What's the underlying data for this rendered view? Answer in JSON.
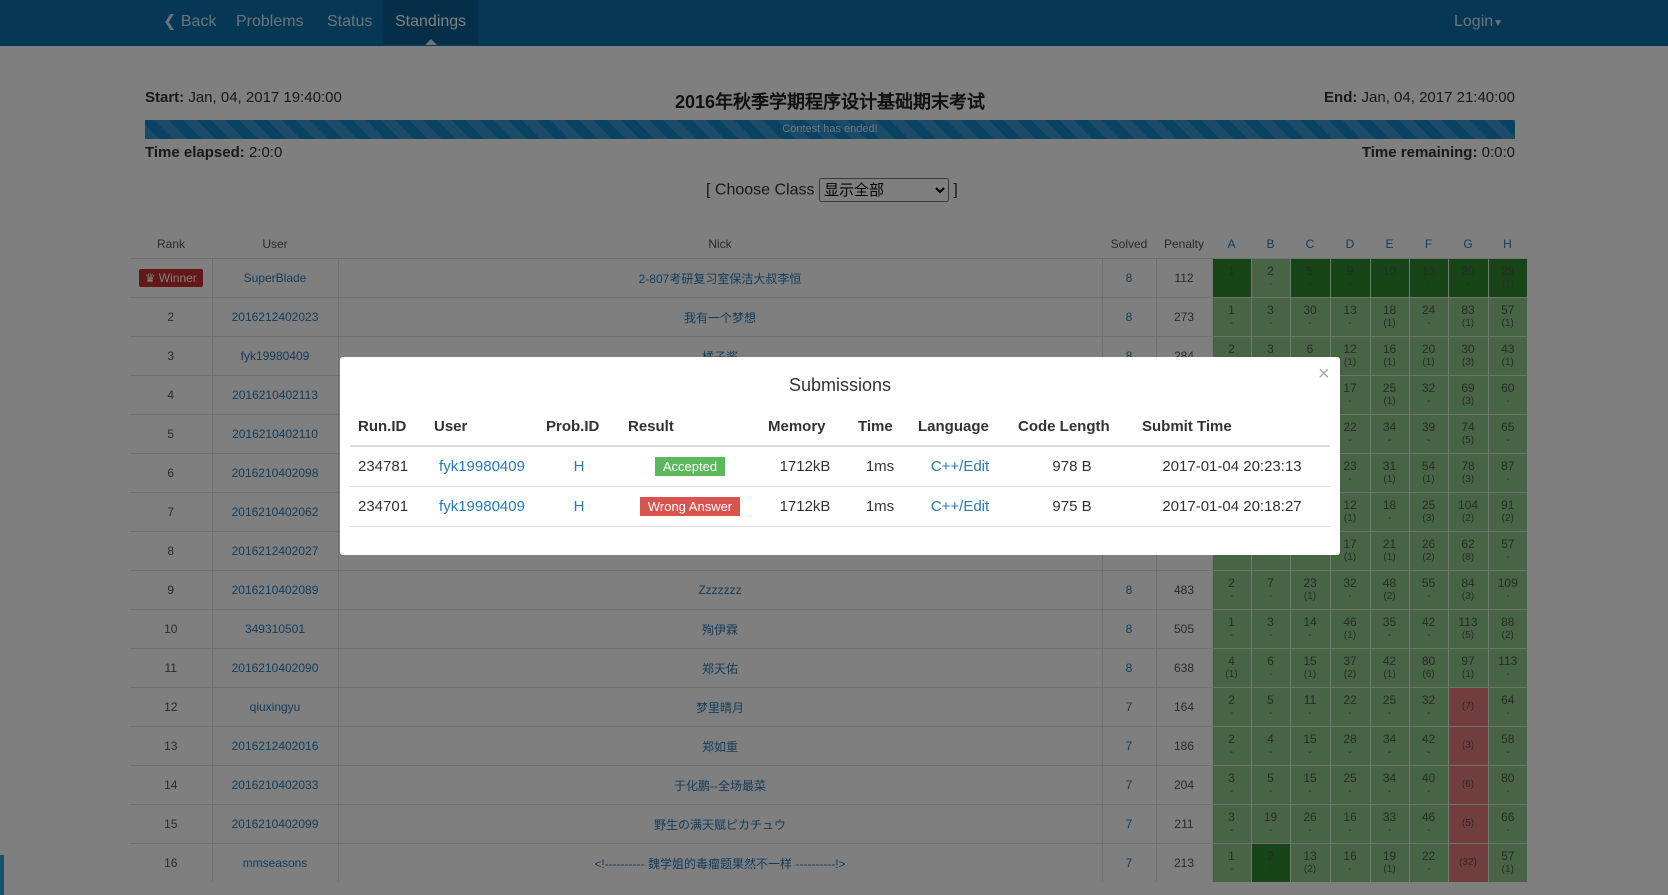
{
  "nav": {
    "back": "Back",
    "problems": "Problems",
    "status": "Status",
    "standings": "Standings",
    "login": "Login"
  },
  "contest": {
    "start_label": "Start:",
    "start": "Jan, 04, 2017 19:40:00",
    "title": "2016年秋季学期程序设计基础期末考试",
    "end_label": "End:",
    "end": "Jan, 04, 2017 21:40:00",
    "progress_text": "Contest has ended!",
    "progress": 1.0,
    "elapsed_label": "Time elapsed:",
    "elapsed": "2:0:0",
    "remaining_label": "Time remaining:",
    "remaining": "0:0:0",
    "choose_class_open": "[ Choose Class",
    "choose_class_close": "]",
    "class_selected": "显示全部"
  },
  "standings": {
    "headers": {
      "rank": "Rank",
      "user": "User",
      "nick": "Nick",
      "solved": "Solved",
      "penalty": "Penalty"
    },
    "problems": [
      "A",
      "B",
      "C",
      "D",
      "E",
      "F",
      "G",
      "H"
    ],
    "winner_label": "Winner",
    "rows": [
      {
        "rank": "Winner",
        "user": "SuperBlade",
        "nick": "2-807考研复习室保洁大叔李恒",
        "solved": "8",
        "penalty": "112",
        "cells": [
          [
            "1",
            "-",
            "first"
          ],
          [
            "2",
            "-",
            "g"
          ],
          [
            "5",
            "-",
            "first"
          ],
          [
            "9",
            "-",
            "first"
          ],
          [
            "10",
            "-",
            "first"
          ],
          [
            "13",
            "-",
            "first"
          ],
          [
            "20",
            "-",
            "first"
          ],
          [
            "28",
            "(1)",
            "first"
          ]
        ]
      },
      {
        "rank": "2",
        "user": "2016212402023",
        "nick": "我有一个梦想",
        "solved": "8",
        "penalty": "273",
        "cells": [
          [
            "1",
            "-",
            "g"
          ],
          [
            "3",
            "-",
            "g"
          ],
          [
            "30",
            "-",
            "g"
          ],
          [
            "13",
            "-",
            "g"
          ],
          [
            "18",
            "(1)",
            "g"
          ],
          [
            "24",
            "-",
            "g"
          ],
          [
            "83",
            "(1)",
            "g"
          ],
          [
            "57",
            "(1)",
            "g"
          ]
        ]
      },
      {
        "rank": "3",
        "user": "fyk19980409",
        "nick": "橘子酱",
        "solved": "8",
        "penalty": "284",
        "cells": [
          [
            "2",
            "-",
            "g"
          ],
          [
            "3",
            "-",
            "g"
          ],
          [
            "6",
            "-",
            "g"
          ],
          [
            "12",
            "(1)",
            "g"
          ],
          [
            "16",
            "(1)",
            "g"
          ],
          [
            "20",
            "(1)",
            "g"
          ],
          [
            "30",
            "(3)",
            "g"
          ],
          [
            "43",
            "(1)",
            "g"
          ]
        ]
      },
      {
        "rank": "4",
        "user": "2016210402113",
        "nick": "",
        "solved": "",
        "penalty": "",
        "cells": [
          [
            "",
            "",
            "g"
          ],
          [
            "",
            "",
            "g"
          ],
          [
            "",
            "",
            "g"
          ],
          [
            "17",
            "-",
            "g"
          ],
          [
            "25",
            "(1)",
            "g"
          ],
          [
            "32",
            "-",
            "g"
          ],
          [
            "69",
            "(3)",
            "g"
          ],
          [
            "60",
            "-",
            "g"
          ]
        ]
      },
      {
        "rank": "5",
        "user": "2016210402110",
        "nick": "",
        "solved": "",
        "penalty": "",
        "cells": [
          [
            "",
            "",
            "g"
          ],
          [
            "",
            "",
            "g"
          ],
          [
            "",
            "",
            "g"
          ],
          [
            "22",
            "-",
            "g"
          ],
          [
            "34",
            "-",
            "g"
          ],
          [
            "39",
            "-",
            "g"
          ],
          [
            "74",
            "(5)",
            "g"
          ],
          [
            "65",
            "-",
            "g"
          ]
        ]
      },
      {
        "rank": "6",
        "user": "2016210402098",
        "nick": "",
        "solved": "",
        "penalty": "",
        "cells": [
          [
            "",
            "",
            "g"
          ],
          [
            "",
            "",
            "g"
          ],
          [
            "",
            "",
            "g"
          ],
          [
            "23",
            "-",
            "g"
          ],
          [
            "31",
            "(1)",
            "g"
          ],
          [
            "54",
            "(1)",
            "g"
          ],
          [
            "78",
            "(3)",
            "g"
          ],
          [
            "87",
            "-",
            "g"
          ]
        ]
      },
      {
        "rank": "7",
        "user": "2016210402062",
        "nick": "",
        "solved": "",
        "penalty": "",
        "cells": [
          [
            "",
            "",
            "g"
          ],
          [
            "",
            "",
            "g"
          ],
          [
            "",
            "",
            "g"
          ],
          [
            "12",
            "(1)",
            "g"
          ],
          [
            "18",
            "-",
            "g"
          ],
          [
            "25",
            "(3)",
            "g"
          ],
          [
            "104",
            "(2)",
            "g"
          ],
          [
            "91",
            "(2)",
            "g"
          ]
        ]
      },
      {
        "rank": "8",
        "user": "2016212402027",
        "nick": "",
        "solved": "",
        "penalty": "",
        "cells": [
          [
            "",
            "",
            "g"
          ],
          [
            "",
            "",
            "g"
          ],
          [
            "",
            "",
            "g"
          ],
          [
            "17",
            "(1)",
            "g"
          ],
          [
            "21",
            "(1)",
            "g"
          ],
          [
            "26",
            "(2)",
            "g"
          ],
          [
            "62",
            "(8)",
            "g"
          ],
          [
            "57",
            "-",
            "g"
          ]
        ]
      },
      {
        "rank": "9",
        "user": "2016210402089",
        "nick": "Zzzzzzz",
        "solved": "8",
        "penalty": "483",
        "cells": [
          [
            "2",
            "-",
            "g"
          ],
          [
            "7",
            "-",
            "g"
          ],
          [
            "23",
            "(1)",
            "g"
          ],
          [
            "32",
            "-",
            "g"
          ],
          [
            "48",
            "(2)",
            "g"
          ],
          [
            "55",
            "-",
            "g"
          ],
          [
            "84",
            "(3)",
            "g"
          ],
          [
            "109",
            "-",
            "g"
          ]
        ]
      },
      {
        "rank": "10",
        "user": "349310501",
        "nick": "殉伊霖",
        "solved": "8",
        "penalty": "505",
        "cells": [
          [
            "1",
            "-",
            "g"
          ],
          [
            "3",
            "-",
            "g"
          ],
          [
            "14",
            "-",
            "g"
          ],
          [
            "46",
            "(1)",
            "g"
          ],
          [
            "35",
            "-",
            "g"
          ],
          [
            "42",
            "-",
            "g"
          ],
          [
            "113",
            "(5)",
            "g"
          ],
          [
            "88",
            "(2)",
            "g"
          ]
        ]
      },
      {
        "rank": "11",
        "user": "2016210402090",
        "nick": "郑天佑",
        "solved": "8",
        "penalty": "638",
        "cells": [
          [
            "4",
            "(1)",
            "g"
          ],
          [
            "6",
            "-",
            "g"
          ],
          [
            "15",
            "(1)",
            "g"
          ],
          [
            "37",
            "(2)",
            "g"
          ],
          [
            "42",
            "(1)",
            "g"
          ],
          [
            "80",
            "(6)",
            "g"
          ],
          [
            "97",
            "(1)",
            "g"
          ],
          [
            "113",
            "-",
            "g"
          ]
        ]
      },
      {
        "rank": "12",
        "user": "qiuxingyu",
        "nick": "梦里晴月",
        "solved": "7",
        "penalty": "164",
        "cells": [
          [
            "2",
            "-",
            "g"
          ],
          [
            "5",
            "-",
            "g"
          ],
          [
            "11",
            "-",
            "g"
          ],
          [
            "22",
            "-",
            "g"
          ],
          [
            "25",
            "-",
            "g"
          ],
          [
            "32",
            "-",
            "g"
          ],
          [
            "",
            "(7)",
            "r"
          ],
          [
            "64",
            "-",
            "g"
          ]
        ]
      },
      {
        "rank": "13",
        "user": "2016212402016",
        "nick": "郑如重",
        "solved": "7",
        "penalty": "186",
        "cells": [
          [
            "2",
            "-",
            "g"
          ],
          [
            "4",
            "-",
            "g"
          ],
          [
            "15",
            "-",
            "g"
          ],
          [
            "28",
            "-",
            "g"
          ],
          [
            "34",
            "-",
            "g"
          ],
          [
            "42",
            "-",
            "g"
          ],
          [
            "",
            "(3)",
            "r"
          ],
          [
            "58",
            "-",
            "g"
          ]
        ]
      },
      {
        "rank": "14",
        "user": "2016210402033",
        "nick": "于化鹏--全场最菜",
        "solved": "7",
        "penalty": "204",
        "cells": [
          [
            "3",
            "-",
            "g"
          ],
          [
            "5",
            "-",
            "g"
          ],
          [
            "15",
            "-",
            "g"
          ],
          [
            "25",
            "-",
            "g"
          ],
          [
            "34",
            "-",
            "g"
          ],
          [
            "40",
            "-",
            "g"
          ],
          [
            "",
            "(6)",
            "r"
          ],
          [
            "80",
            "-",
            "g"
          ]
        ]
      },
      {
        "rank": "15",
        "user": "2016210402099",
        "nick": "野生の满天赋ピカチュウ",
        "solved": "7",
        "penalty": "211",
        "cells": [
          [
            "3",
            "-",
            "g"
          ],
          [
            "19",
            "-",
            "g"
          ],
          [
            "26",
            "-",
            "g"
          ],
          [
            "16",
            "-",
            "g"
          ],
          [
            "33",
            "-",
            "g"
          ],
          [
            "46",
            "-",
            "g"
          ],
          [
            "",
            "(5)",
            "r"
          ],
          [
            "66",
            "-",
            "g"
          ]
        ]
      },
      {
        "rank": "16",
        "user": "mmseasons",
        "nick": "<!---------- 魏学姐的毒瘤题果然不一样 ----------!>",
        "solved": "7",
        "penalty": "213",
        "cells": [
          [
            "1",
            "-",
            "g"
          ],
          [
            "2",
            "-",
            "first"
          ],
          [
            "13",
            "(2)",
            "g"
          ],
          [
            "16",
            "-",
            "g"
          ],
          [
            "19",
            "(1)",
            "g"
          ],
          [
            "22",
            "-",
            "g"
          ],
          [
            "",
            "(32)",
            "r"
          ],
          [
            "57",
            "(1)",
            "g"
          ]
        ]
      }
    ]
  },
  "modal": {
    "title": "Submissions",
    "close": "×",
    "headers": [
      "Run.ID",
      "User",
      "Prob.ID",
      "Result",
      "Memory",
      "Time",
      "Language",
      "Code Length",
      "Submit Time"
    ],
    "rows": [
      {
        "run_id": "234781",
        "user": "fyk19980409",
        "prob": "H",
        "result": "Accepted",
        "memory": "1712kB",
        "time": "1ms",
        "language": "C++/Edit",
        "code_length": "978 B",
        "submit_time": "2017-01-04 20:23:13"
      },
      {
        "run_id": "234701",
        "user": "fyk19980409",
        "prob": "H",
        "result": "Wrong Answer",
        "memory": "1712kB",
        "time": "1ms",
        "language": "C++/Edit",
        "code_length": "975 B",
        "submit_time": "2017-01-04 20:18:27"
      }
    ]
  },
  "colors": {
    "navbar": "#0c6ea8",
    "accepted": "#5cb85c",
    "wrong": "#d9534f",
    "first_solve": "#2e8a2e",
    "solved_cell": "#8fc98a",
    "failed_cell": "#e27b7b"
  }
}
